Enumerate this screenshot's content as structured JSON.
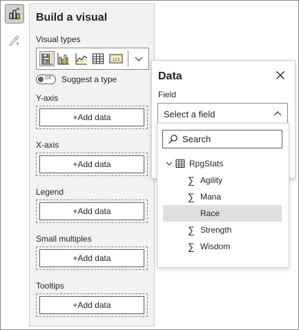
{
  "build_pane": {
    "title": "Build a visual",
    "visual_types_label": "Visual types",
    "visual_types": [
      "stacked-bar-chart-icon",
      "clustered-column-chart-icon",
      "line-chart-icon",
      "table-icon",
      "card-icon"
    ],
    "suggest_toggle": {
      "state_text": "Off",
      "label": "Suggest a type"
    },
    "wells": [
      {
        "label": "Y-axis",
        "button": "+Add data"
      },
      {
        "label": "X-axis",
        "button": "+Add data"
      },
      {
        "label": "Legend",
        "button": "+Add data"
      },
      {
        "label": "Small multiples",
        "button": "+Add data"
      },
      {
        "label": "Tooltips",
        "button": "+Add data"
      }
    ]
  },
  "data_pane": {
    "title": "Data",
    "field_label": "Field",
    "select_text": "Select a field",
    "search_placeholder": "Search",
    "table_name": "RpgStats",
    "fields": [
      {
        "name": "Agility",
        "aggregate": true
      },
      {
        "name": "Mana",
        "aggregate": true
      },
      {
        "name": "Race",
        "aggregate": false
      },
      {
        "name": "Strength",
        "aggregate": true
      },
      {
        "name": "Wisdom",
        "aggregate": true
      }
    ],
    "sigma_glyph": "∑"
  },
  "colors": {
    "accent_yellow": "#f2c811",
    "selected_bg": "#e1dfdd",
    "pane_bg": "#f3f2f1"
  }
}
